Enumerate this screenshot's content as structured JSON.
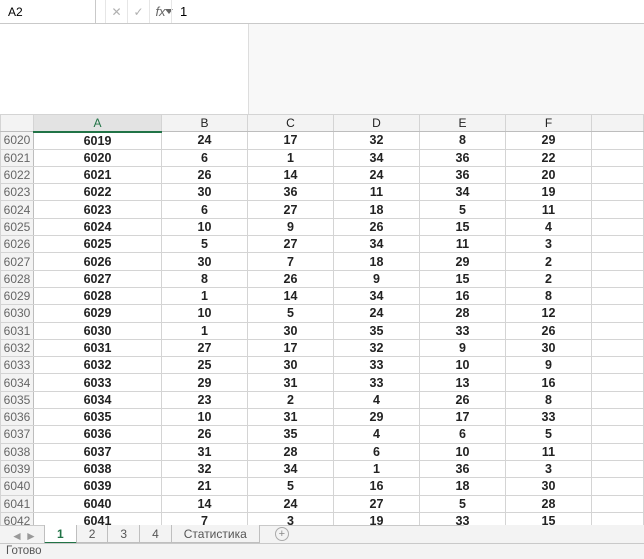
{
  "namebox": {
    "value": "A2"
  },
  "formula_bar": {
    "cancel_tip": "✕",
    "enter_tip": "✓",
    "fx_label": "fx",
    "value": "1"
  },
  "columns": [
    "A",
    "B",
    "C",
    "D",
    "E",
    "F"
  ],
  "selected_column": "A",
  "row_start": 6020,
  "row_end": 6042,
  "chart_data": {
    "type": "table",
    "columns": [
      "A",
      "B",
      "C",
      "D",
      "E",
      "F"
    ],
    "rows": [
      {
        "n": 6020,
        "A": 6019,
        "B": 24,
        "C": 17,
        "D": 32,
        "E": 8,
        "F": 29
      },
      {
        "n": 6021,
        "A": 6020,
        "B": 6,
        "C": 1,
        "D": 34,
        "E": 36,
        "F": 22
      },
      {
        "n": 6022,
        "A": 6021,
        "B": 26,
        "C": 14,
        "D": 24,
        "E": 36,
        "F": 20
      },
      {
        "n": 6023,
        "A": 6022,
        "B": 30,
        "C": 36,
        "D": 11,
        "E": 34,
        "F": 19
      },
      {
        "n": 6024,
        "A": 6023,
        "B": 6,
        "C": 27,
        "D": 18,
        "E": 5,
        "F": 11
      },
      {
        "n": 6025,
        "A": 6024,
        "B": 10,
        "C": 9,
        "D": 26,
        "E": 15,
        "F": 4
      },
      {
        "n": 6026,
        "A": 6025,
        "B": 5,
        "C": 27,
        "D": 34,
        "E": 11,
        "F": 3
      },
      {
        "n": 6027,
        "A": 6026,
        "B": 30,
        "C": 7,
        "D": 18,
        "E": 29,
        "F": 2
      },
      {
        "n": 6028,
        "A": 6027,
        "B": 8,
        "C": 26,
        "D": 9,
        "E": 15,
        "F": 2
      },
      {
        "n": 6029,
        "A": 6028,
        "B": 1,
        "C": 14,
        "D": 34,
        "E": 16,
        "F": 8
      },
      {
        "n": 6030,
        "A": 6029,
        "B": 10,
        "C": 5,
        "D": 24,
        "E": 28,
        "F": 12
      },
      {
        "n": 6031,
        "A": 6030,
        "B": 1,
        "C": 30,
        "D": 35,
        "E": 33,
        "F": 26
      },
      {
        "n": 6032,
        "A": 6031,
        "B": 27,
        "C": 17,
        "D": 32,
        "E": 9,
        "F": 30
      },
      {
        "n": 6033,
        "A": 6032,
        "B": 25,
        "C": 30,
        "D": 33,
        "E": 10,
        "F": 9
      },
      {
        "n": 6034,
        "A": 6033,
        "B": 29,
        "C": 31,
        "D": 33,
        "E": 13,
        "F": 16
      },
      {
        "n": 6035,
        "A": 6034,
        "B": 23,
        "C": 2,
        "D": 4,
        "E": 26,
        "F": 8
      },
      {
        "n": 6036,
        "A": 6035,
        "B": 10,
        "C": 31,
        "D": 29,
        "E": 17,
        "F": 33
      },
      {
        "n": 6037,
        "A": 6036,
        "B": 26,
        "C": 35,
        "D": 4,
        "E": 6,
        "F": 5
      },
      {
        "n": 6038,
        "A": 6037,
        "B": 31,
        "C": 28,
        "D": 6,
        "E": 10,
        "F": 11
      },
      {
        "n": 6039,
        "A": 6038,
        "B": 32,
        "C": 34,
        "D": 1,
        "E": 36,
        "F": 3
      },
      {
        "n": 6040,
        "A": 6039,
        "B": 21,
        "C": 5,
        "D": 16,
        "E": 18,
        "F": 30
      },
      {
        "n": 6041,
        "A": 6040,
        "B": 14,
        "C": 24,
        "D": 27,
        "E": 5,
        "F": 28
      },
      {
        "n": 6042,
        "A": 6041,
        "B": 7,
        "C": 3,
        "D": 19,
        "E": 33,
        "F": 15
      }
    ]
  },
  "sheet_tabs": {
    "items": [
      {
        "label": "1",
        "active": true
      },
      {
        "label": "2",
        "active": false
      },
      {
        "label": "3",
        "active": false
      },
      {
        "label": "4",
        "active": false
      },
      {
        "label": "Статистика",
        "active": false
      }
    ],
    "add_tip": "+"
  },
  "status_bar": {
    "text": "Готово"
  }
}
